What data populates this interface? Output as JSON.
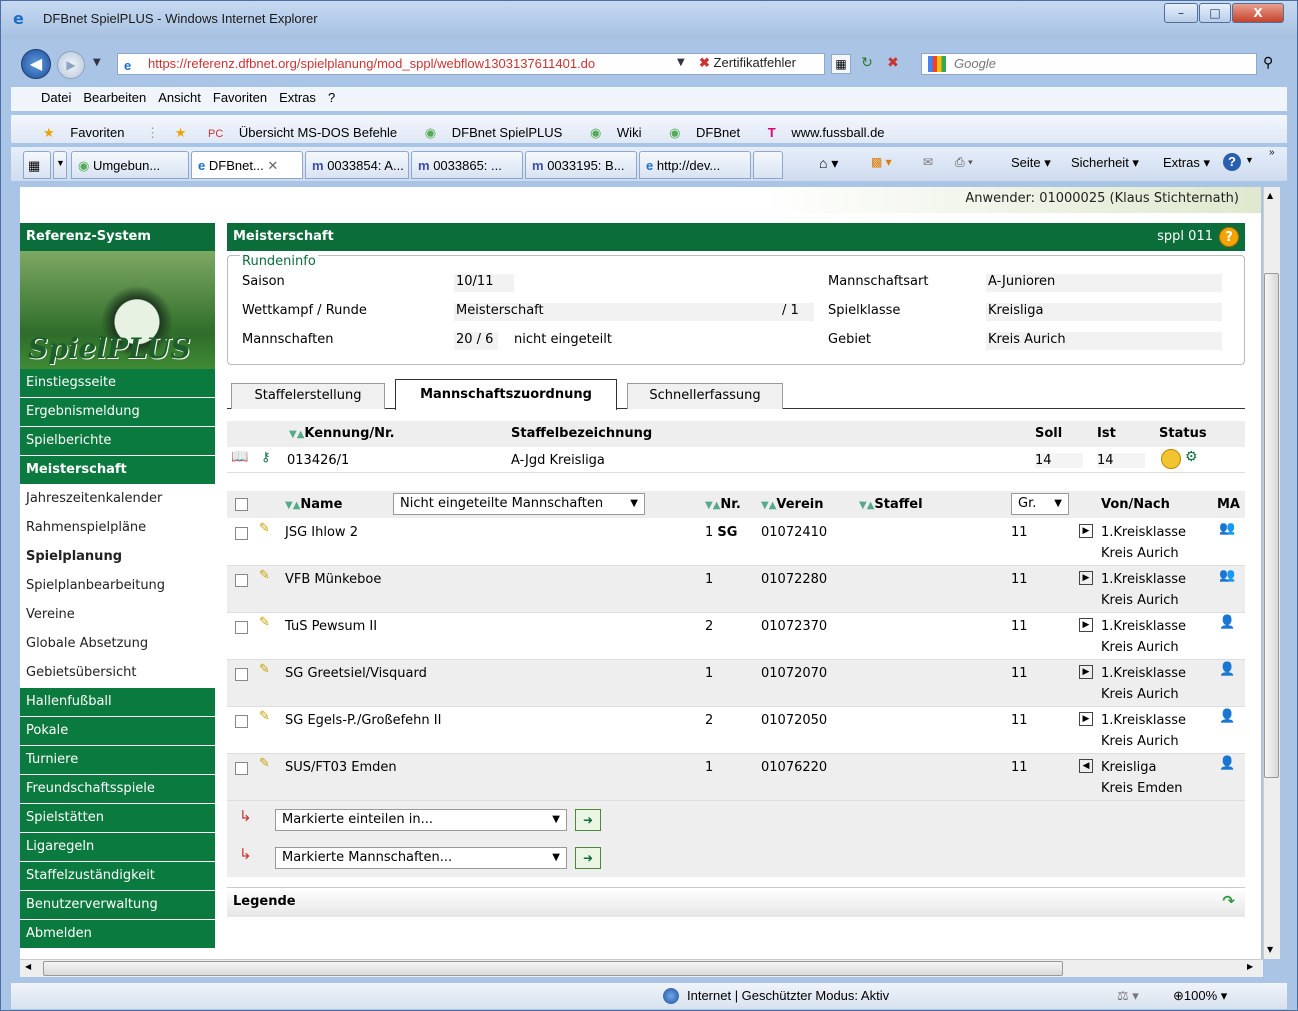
{
  "window": {
    "title": "DFBnet SpielPLUS - Windows Internet Explorer",
    "minimize": "–",
    "maximize": "□",
    "close": "X"
  },
  "address": {
    "url": "https://referenz.dfbnet.org/spielplanung/mod_sppl/webflow1303137611401.do",
    "cert_error": "Zertifikatfehler",
    "search_placeholder": "Google"
  },
  "menu": [
    "Datei",
    "Bearbeiten",
    "Ansicht",
    "Favoriten",
    "Extras",
    "?"
  ],
  "favorites": {
    "label": "Favoriten",
    "items": [
      "Übersicht MS-DOS Befehle",
      "DFBnet SpielPLUS",
      "Wiki",
      "DFBnet",
      "www.fussball.de"
    ]
  },
  "tabs": [
    "Umgebun...",
    "DFBnet...",
    "0033854: A...",
    "0033865: ...",
    "0033195: B...",
    "http://dev..."
  ],
  "toolbar": {
    "seite": "Seite",
    "sicherheit": "Sicherheit",
    "extras": "Extras"
  },
  "user": "Anwender: 01000025 (Klaus Stichternath)",
  "sidebar": {
    "title": "Referenz-System",
    "logo": "SpielPLUS",
    "items": [
      {
        "label": "Einstiegsseite",
        "style": "green"
      },
      {
        "label": "Ergebnismeldung",
        "style": "green"
      },
      {
        "label": "Spielberichte",
        "style": "green"
      },
      {
        "label": "Meisterschaft",
        "style": "green-bold"
      },
      {
        "label": "Jahreszeitenkalender",
        "style": "white"
      },
      {
        "label": "Rahmenspielpläne",
        "style": "white"
      },
      {
        "label": "Spielplanung",
        "style": "white-bold"
      },
      {
        "label": "Spielplanbearbeitung",
        "style": "white"
      },
      {
        "label": "Vereine",
        "style": "white"
      },
      {
        "label": "Globale Absetzung",
        "style": "white"
      },
      {
        "label": "Gebietsübersicht",
        "style": "white"
      },
      {
        "label": "Hallenfußball",
        "style": "green"
      },
      {
        "label": "Pokale",
        "style": "green"
      },
      {
        "label": "Turniere",
        "style": "green"
      },
      {
        "label": "Freundschaftsspiele",
        "style": "green"
      },
      {
        "label": "Spielstätten",
        "style": "green"
      },
      {
        "label": "Ligaregeln",
        "style": "green"
      },
      {
        "label": "Staffelzuständigkeit",
        "style": "green"
      },
      {
        "label": "Benutzerverwaltung",
        "style": "green"
      },
      {
        "label": "Abmelden",
        "style": "green"
      }
    ]
  },
  "main": {
    "title": "Meisterschaft",
    "code": "sppl 011",
    "help": "?",
    "rundeninfo": {
      "legend": "Rundeninfo",
      "saison_label": "Saison",
      "saison": "10/11",
      "wettkampf_label": "Wettkampf / Runde",
      "wettkampf": "Meisterschaft",
      "runde": "/ 1",
      "mannschaften_label": "Mannschaften",
      "mannschaften": "20 / 6",
      "mannschaften_info": "nicht eingeteilt",
      "mannschaftsart_label": "Mannschaftsart",
      "mannschaftsart": "A-Junioren",
      "spielklasse_label": "Spielklasse",
      "spielklasse": "Kreisliga",
      "gebiet_label": "Gebiet",
      "gebiet": "Kreis Aurich"
    },
    "tabs": [
      "Staffelerstellung",
      "Mannschaftszuordnung",
      "Schnellerfassung"
    ],
    "staffel": {
      "headers": {
        "kennung": "Kennung/Nr.",
        "bez": "Staffelbezeichnung",
        "soll": "Soll",
        "ist": "Ist",
        "status": "Status"
      },
      "row": {
        "kennung": "013426/1",
        "bez": "A-Jgd Kreisliga",
        "soll": "14",
        "ist": "14"
      }
    },
    "grid": {
      "headers": {
        "name": "Name",
        "filter": "Nicht eingeteilte Mannschaften",
        "nr": "Nr.",
        "verein": "Verein",
        "staffel": "Staffel",
        "gr": "Gr.",
        "vonnach": "Von/Nach",
        "ma": "MA"
      },
      "rows": [
        {
          "name": "JSG Ihlow 2",
          "nr": "1",
          "nr_tag": "SG",
          "verein": "01072410",
          "gr": "11",
          "dir": "▶",
          "klasse": "1.Kreisklasse",
          "kreis": "Kreis Aurich",
          "ma": "👥"
        },
        {
          "name": "VFB Münkeboe",
          "nr": "1",
          "nr_tag": "",
          "verein": "01072280",
          "gr": "11",
          "dir": "▶",
          "klasse": "1.Kreisklasse",
          "kreis": "Kreis Aurich",
          "ma": "👥"
        },
        {
          "name": "TuS Pewsum II",
          "nr": "2",
          "nr_tag": "",
          "verein": "01072370",
          "gr": "11",
          "dir": "▶",
          "klasse": "1.Kreisklasse",
          "kreis": "Kreis Aurich",
          "ma": "👤"
        },
        {
          "name": "SG Greetsiel/Visquard",
          "nr": "1",
          "nr_tag": "",
          "verein": "01072070",
          "gr": "11",
          "dir": "▶",
          "klasse": "1.Kreisklasse",
          "kreis": "Kreis Aurich",
          "ma": "👤"
        },
        {
          "name": "SG Egels-P./Großefehn II",
          "nr": "2",
          "nr_tag": "",
          "verein": "01072050",
          "gr": "11",
          "dir": "▶",
          "klasse": "1.Kreisklasse",
          "kreis": "Kreis Aurich",
          "ma": "👤"
        },
        {
          "name": "SUS/FT03 Emden",
          "nr": "1",
          "nr_tag": "",
          "verein": "01076220",
          "gr": "11",
          "dir": "◀",
          "klasse": "Kreisliga",
          "kreis": "Kreis Emden",
          "ma": "👤"
        }
      ]
    },
    "actions": {
      "einteilen": "Markierte einteilen in...",
      "mannschaften": "Markierte Mannschaften..."
    },
    "legende": "Legende"
  },
  "statusbar": {
    "zone": "Internet | Geschützter Modus: Aktiv",
    "zoom": "100%"
  }
}
